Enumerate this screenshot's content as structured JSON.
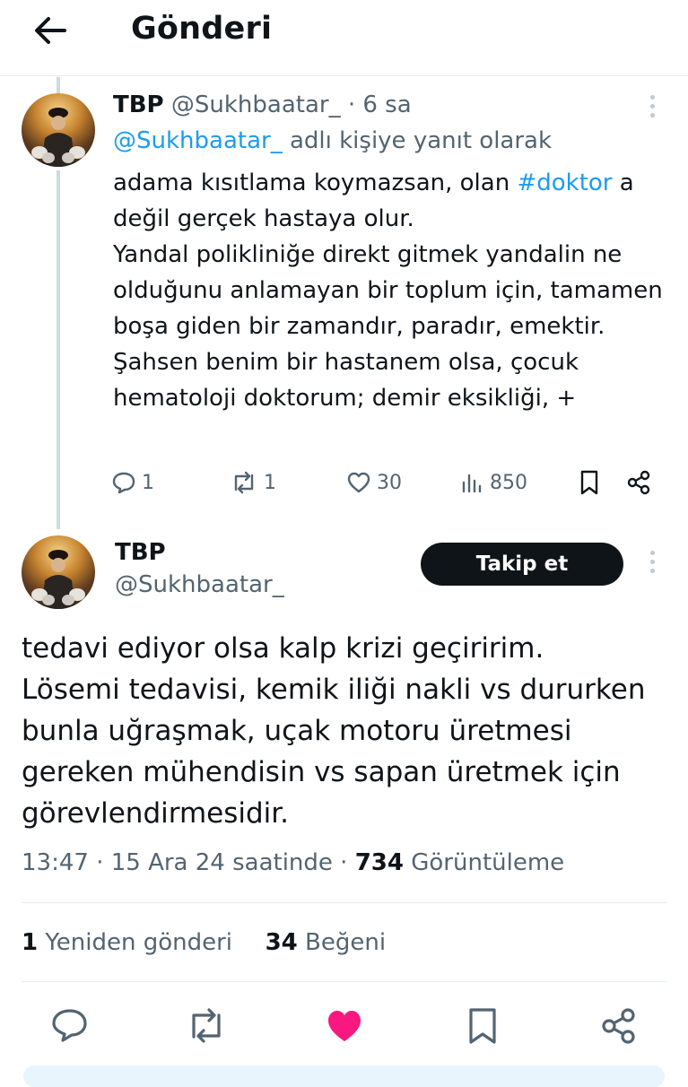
{
  "header": {
    "title": "Gönderi"
  },
  "reply_tweet": {
    "display_name": "TBP",
    "handle": "@Sukhbaatar_",
    "time": "· 6 sa",
    "reply_to_handle": "@Sukhbaatar_",
    "reply_to_suffix": " adlı kişiye yanıt olarak",
    "body_start": "adama kısıtlama koymazsan, olan ",
    "hashtag": "#doktor",
    "body_rest": " a\ndeğil gerçek hastaya olur.\nYandal polikliniğe direkt gitmek yandalin ne olduğunu anlamayan bir toplum için, tamamen boşa giden bir zamandır, paradır, emektir.\nŞahsen benim bir hastanem olsa, çocuk hematoloji doktorum; demir eksikliği, +",
    "replies": "1",
    "reposts": "1",
    "likes": "30",
    "views": "850"
  },
  "main_tweet": {
    "display_name": "TBP",
    "handle": "@Sukhbaatar_",
    "follow_label": "Takip et",
    "body": "tedavi ediyor olsa kalp krizi geçiririm.\nLösemi tedavisi, kemik iliği nakli vs dururken bunla uğraşmak, uçak motoru üretmesi gereken mühendisin vs sapan üretmek için görevlendirmesidir.",
    "timestamp": "13:47 · 15 Ara 24 saatinde · ",
    "views_count": "734",
    "views_label": " Görüntüleme",
    "reposts_count": "1",
    "reposts_label": " Yeniden gönderi",
    "likes_count": "34",
    "likes_label": " Beğeni"
  },
  "colors": {
    "accent": "#1d9bf0",
    "like": "#f91880",
    "muted": "#536471",
    "text": "#0f1419"
  },
  "icons": {
    "back": "arrow-left-icon",
    "more": "more-vertical-icon",
    "reply": "comment-icon",
    "repost": "repost-icon",
    "like": "heart-icon",
    "views": "bar-chart-icon",
    "bookmark": "bookmark-icon",
    "share": "share-icon"
  }
}
